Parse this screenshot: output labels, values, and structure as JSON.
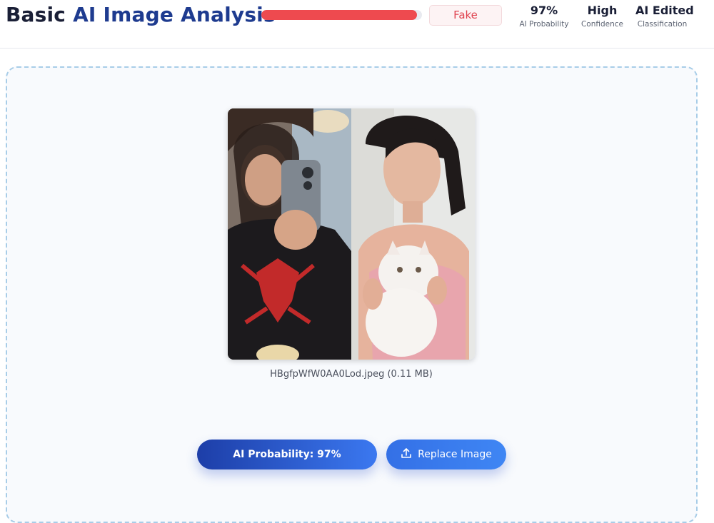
{
  "header": {
    "title_part1": "Basic",
    "title_part2": "AI Image Analysis",
    "verdict": "Fake",
    "stats": {
      "probability_value": "97%",
      "probability_label": "AI Probability",
      "confidence_value": "High",
      "confidence_label": "Confidence",
      "classification_value": "AI Edited",
      "classification_label": "Classification"
    },
    "progress_fraction": 0.97,
    "progress_color": "#ee4a4f"
  },
  "file": {
    "info": "HBgfpWfW0AA0Lod.jpeg (0.11 MB)"
  },
  "actions": {
    "probability_button": "AI Probability: 97%",
    "replace_button": "Replace Image",
    "replace_icon": "upload-icon"
  },
  "colors": {
    "accent": "#1e3b8f",
    "button_blue": "#3b78f0",
    "danger": "#e04450"
  }
}
